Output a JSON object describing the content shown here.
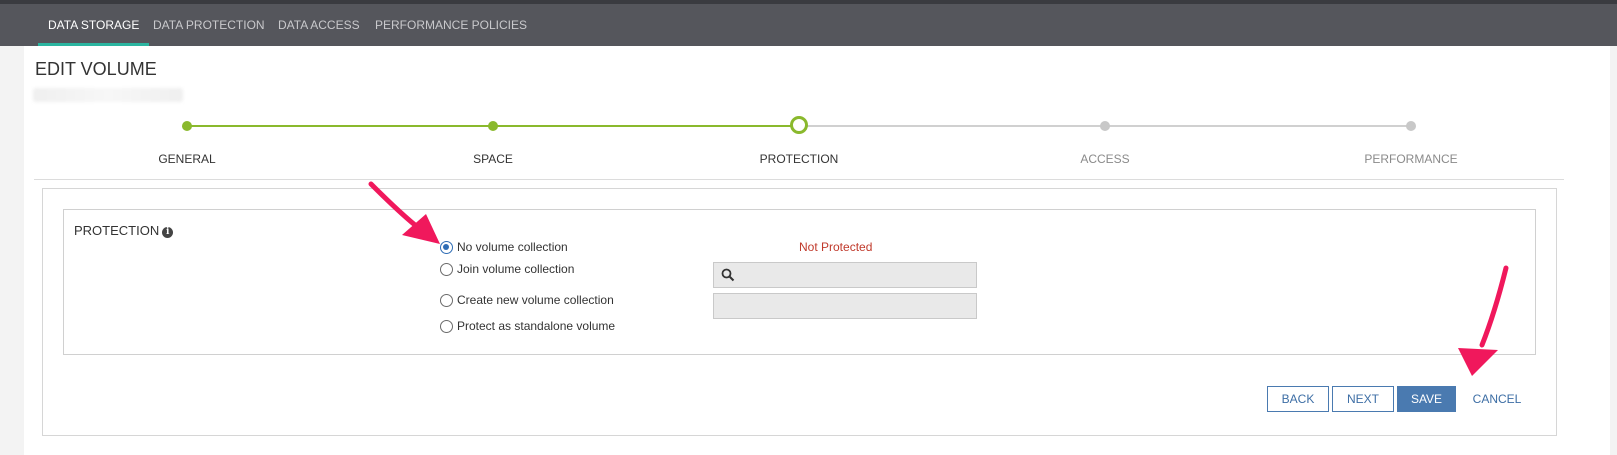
{
  "nav": {
    "tabs": [
      {
        "label": "DATA STORAGE"
      },
      {
        "label": "DATA PROTECTION"
      },
      {
        "label": "DATA ACCESS"
      },
      {
        "label": "PERFORMANCE POLICIES"
      }
    ]
  },
  "page": {
    "title": "EDIT VOLUME"
  },
  "steps": [
    {
      "label": "GENERAL",
      "state": "done"
    },
    {
      "label": "SPACE",
      "state": "done"
    },
    {
      "label": "PROTECTION",
      "state": "current"
    },
    {
      "label": "ACCESS",
      "state": "todo"
    },
    {
      "label": "PERFORMANCE",
      "state": "todo"
    }
  ],
  "protection": {
    "title": "PROTECTION",
    "info_icon": "info-icon",
    "status": "Not Protected",
    "options": [
      {
        "label": "No volume collection",
        "checked": true
      },
      {
        "label": "Join volume collection",
        "checked": false
      },
      {
        "label": "Create new volume collection",
        "checked": false
      },
      {
        "label": "Protect as standalone volume",
        "checked": false
      }
    ]
  },
  "buttons": {
    "back": "BACK",
    "next": "NEXT",
    "save": "SAVE",
    "cancel": "CANCEL"
  },
  "colors": {
    "topbar": "#55565c",
    "active_tab_underline": "#2bb5a0",
    "step_done": "#8ab92d",
    "step_todo": "#c8c8c8",
    "status_red": "#c0392b",
    "primary_blue": "#4a7ab0",
    "annotation_arrow": "#f0185c"
  }
}
